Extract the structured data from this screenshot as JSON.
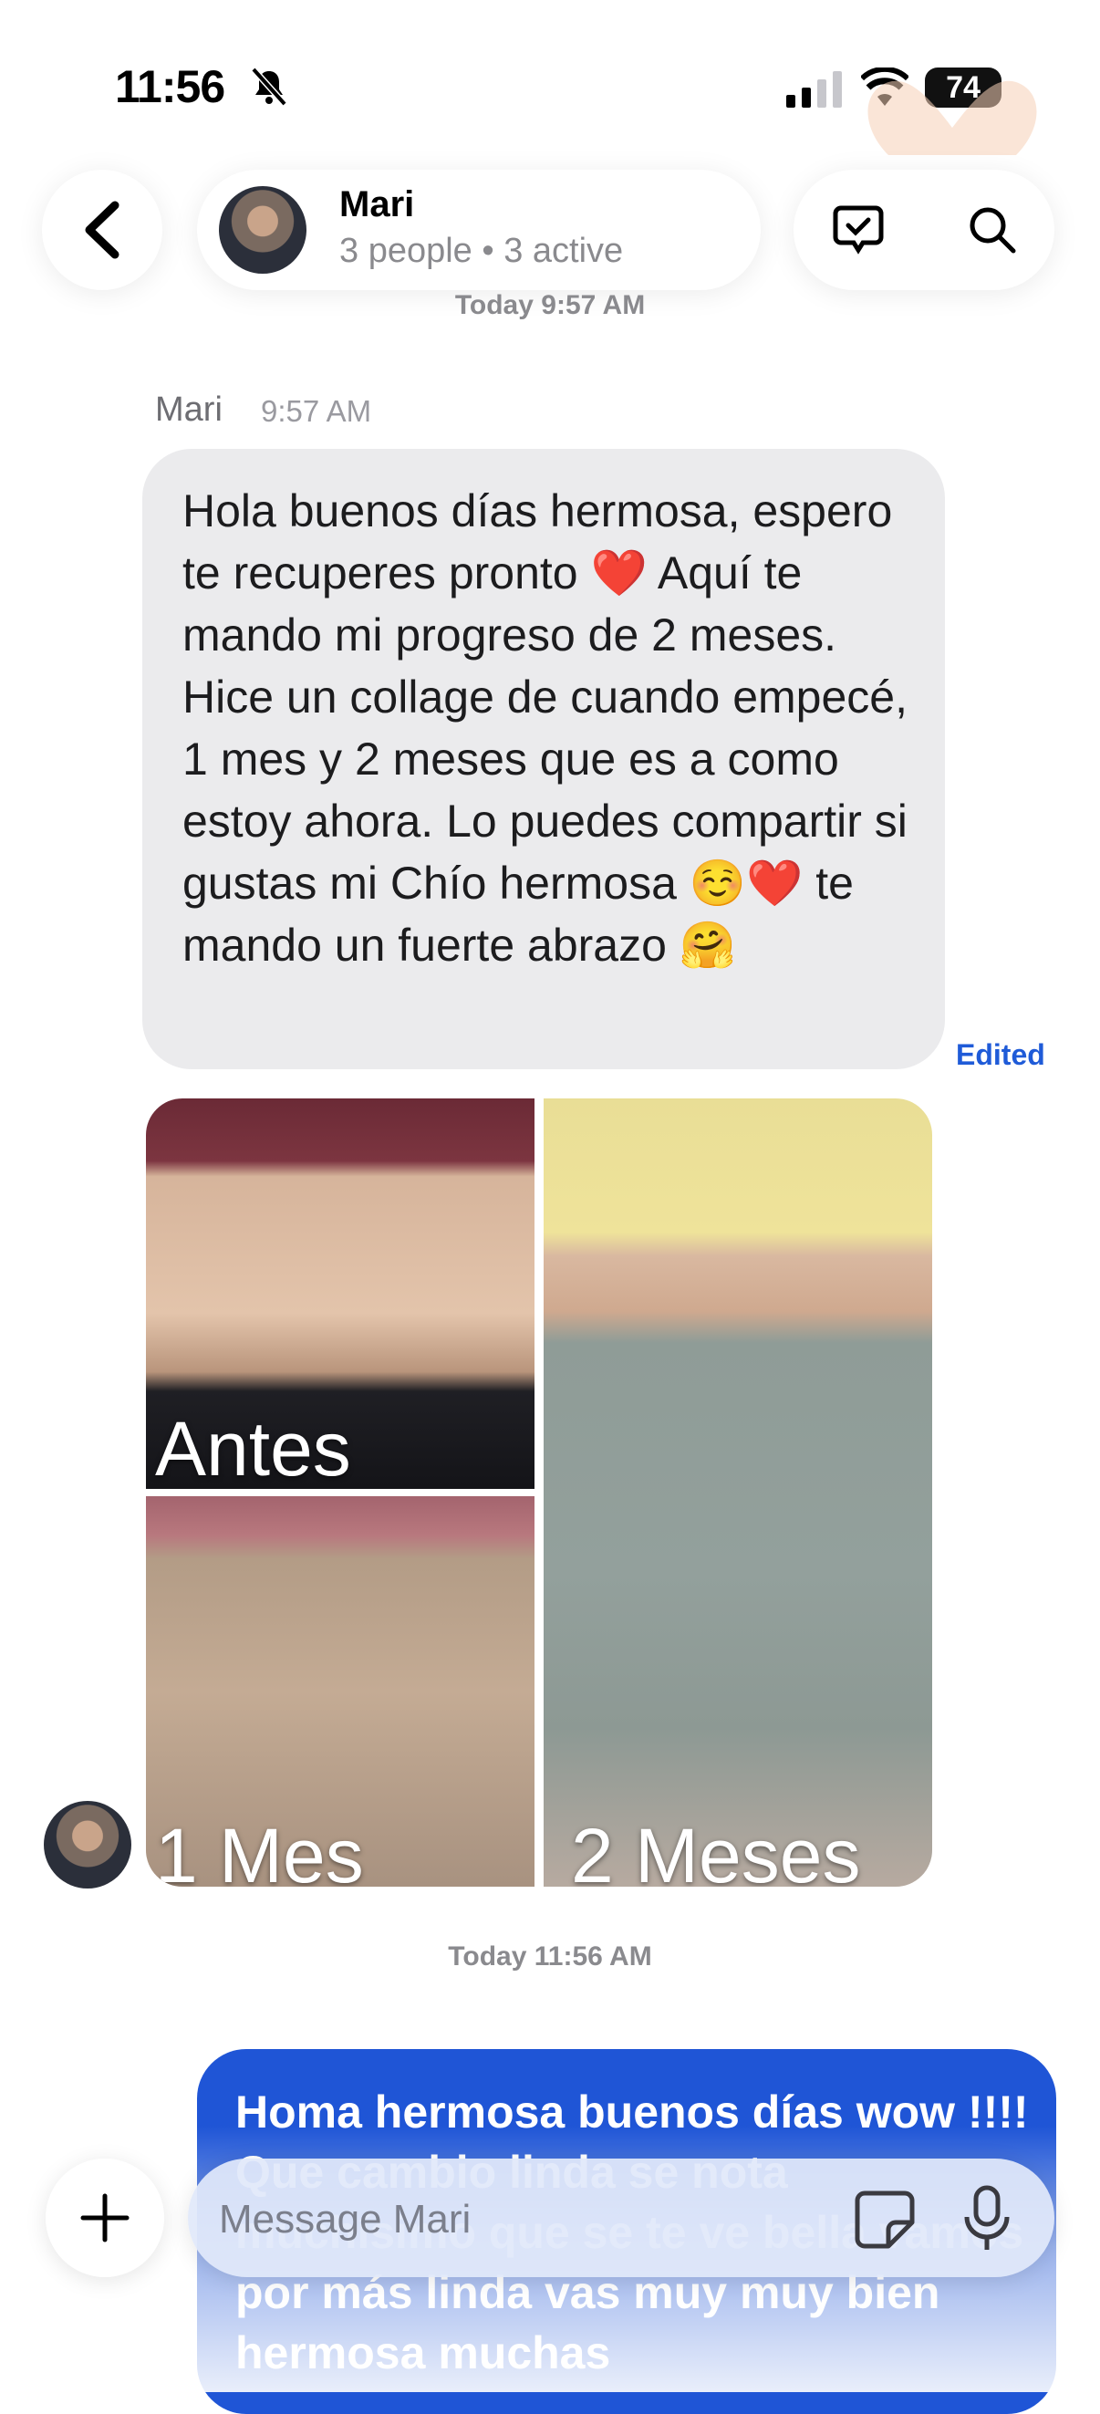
{
  "status_bar": {
    "time": "11:56",
    "battery": "74"
  },
  "header": {
    "name": "Mari",
    "subtitle": "3 people • 3 active"
  },
  "timestamps": {
    "first": "Today 9:57 AM",
    "second": "Today 11:56 AM"
  },
  "message_in": {
    "sender": "Mari",
    "time": "9:57 AM",
    "text": "Hola buenos días hermosa, espero te recuperes pronto ❤️ Aquí te mando mi progreso de 2 meses. Hice un collage de cuando empecé, 1 mes y 2 meses que es a como estoy ahora. Lo puedes compartir si gustas mi Chío hermosa ☺️❤️ te mando un fuerte abrazo 🤗",
    "edited_label": "Edited"
  },
  "collage": {
    "labels": {
      "before": "Antes",
      "one_month": "1 Mes",
      "two_months": "2 Meses"
    }
  },
  "message_out": {
    "text": "Homa hermosa buenos días wow !!!! Que cambio linda se nota muchísimo que se te ve bella vamos por más linda vas muy muy bien hermosa muchas"
  },
  "composer": {
    "placeholder": "Message Mari"
  },
  "colors": {
    "outgoing_bubble": "#1f55d6",
    "incoming_bubble": "#ebebed",
    "edited": "#1f5bd8"
  },
  "icons": [
    "bell-slash-icon",
    "signal-icon",
    "wifi-icon",
    "battery-icon",
    "back-chevron-icon",
    "checklist-icon",
    "search-icon",
    "plus-icon",
    "sticker-icon",
    "microphone-icon"
  ]
}
